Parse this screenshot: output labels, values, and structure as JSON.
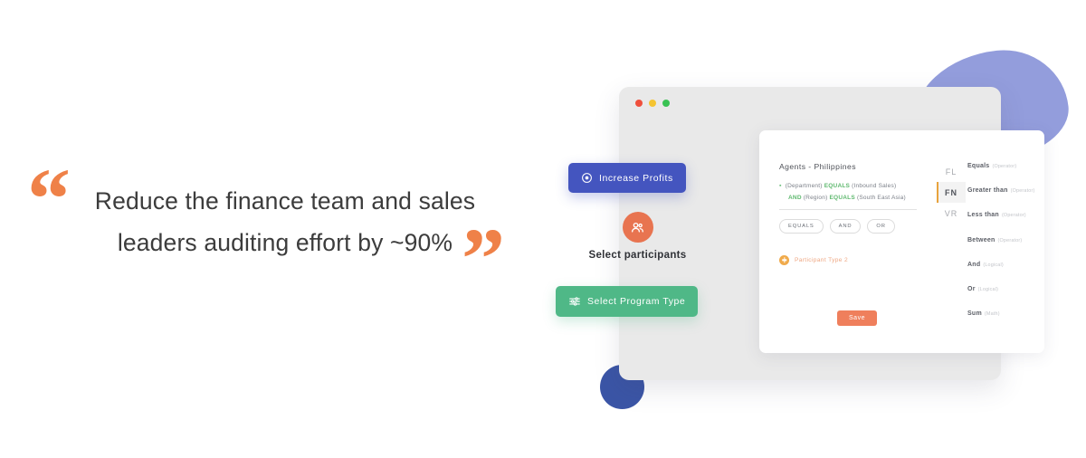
{
  "quote": {
    "open_mark": "“",
    "close_mark": "”",
    "text": "Reduce the finance team and sales leaders auditing effort by ~90%",
    "accent_color": "#ef8148",
    "text_color": "#3c3c3c"
  },
  "mockup": {
    "window_dots": [
      "#ef4f3c",
      "#f5c431",
      "#39c253"
    ],
    "rule_builder": {
      "title": "Agents - Philippines",
      "bullet": "▪",
      "conditions": [
        {
          "field": "(Department)",
          "operator": "EQUALS",
          "value": "(Inbound Sales)"
        },
        {
          "logical": "AND",
          "field": "(Region)",
          "operator": "EQUALS",
          "value": "(South East Asia)"
        }
      ],
      "chips": [
        "EQUALS",
        "AND",
        "OR"
      ],
      "participant_type": "Participant Type 2",
      "save_label": "Save",
      "save_color": "#ef7f5c"
    },
    "tabs": [
      {
        "label": "FL",
        "active": false
      },
      {
        "label": "FN",
        "active": true
      },
      {
        "label": "VR",
        "active": false
      }
    ],
    "tab_active_color": "#e8a33d",
    "operators": [
      {
        "name": "Equals",
        "kind": "(Operator)"
      },
      {
        "name": "Greater than",
        "kind": "(Operator)"
      },
      {
        "name": "Less than",
        "kind": "(Operator)"
      },
      {
        "name": "Between",
        "kind": "(Operator)"
      },
      {
        "name": "And",
        "kind": "(Logical)"
      },
      {
        "name": "Or",
        "kind": "(Logical)"
      },
      {
        "name": "Sum",
        "kind": "(Math)"
      }
    ],
    "floating": {
      "increase_profits": {
        "label": "Increase Profits",
        "icon": "target-icon",
        "color": "#4455bf"
      },
      "participants": {
        "label": "Select participants",
        "icon": "users-icon",
        "color": "#e87450"
      },
      "select_program": {
        "label": "Select Program Type",
        "icon": "sliders-icon",
        "color": "#4fb887"
      }
    },
    "decor": {
      "blob_color": "#939ddc",
      "circle_color": "#3b55a6",
      "window_color": "#e9e9e9",
      "card_color": "#ffffff"
    }
  }
}
